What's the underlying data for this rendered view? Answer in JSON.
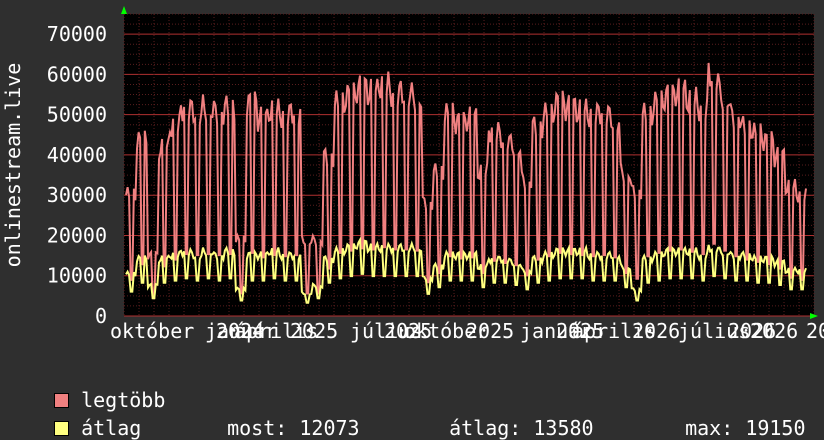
{
  "chart_data": {
    "type": "line",
    "ylabel": "onlinestream.live",
    "yticks": [
      "0",
      "10000",
      "20000",
      "30000",
      "40000",
      "50000",
      "60000",
      "70000"
    ],
    "ylim": [
      0,
      75000
    ],
    "x_tick_labels": [
      "október",
      "január",
      "2024",
      "április",
      "2025",
      "július",
      "2025",
      "október",
      "2025",
      "január",
      "2025",
      "április",
      "2026",
      "július",
      "2026",
      "2026",
      "20"
    ],
    "grid": true,
    "series": [
      {
        "name": "legtöbb",
        "color": "#f08080",
        "values": [
          32000,
          46000,
          16000,
          44000,
          50000,
          55000,
          54000,
          55000,
          54000,
          55000,
          20000,
          56000,
          52000,
          54000,
          53000,
          54000,
          20000,
          20000,
          42000,
          56000,
          58000,
          60000,
          59000,
          61000,
          59000,
          59000,
          58000,
          30000,
          38000,
          53000,
          51000,
          52000,
          38000,
          49000,
          47000,
          45000,
          36000,
          50000,
          53000,
          56000,
          55000,
          54000,
          53000,
          54000,
          52000,
          38000,
          33000,
          53000,
          56000,
          58000,
          59000,
          57000,
          55000,
          64000,
          58000,
          53000,
          50000,
          48000,
          46000,
          42000,
          34000,
          32000
        ]
      },
      {
        "name": "átlag",
        "color": "#ffff80",
        "values": [
          11000,
          15000,
          8000,
          15000,
          16000,
          17000,
          16000,
          17000,
          16000,
          17000,
          7000,
          16000,
          16000,
          17000,
          16000,
          16000,
          6000,
          8000,
          15000,
          17000,
          18000,
          19000,
          18000,
          18000,
          18000,
          18000,
          18000,
          10000,
          13000,
          16000,
          16000,
          16000,
          13000,
          15000,
          15000,
          14000,
          12000,
          15000,
          16000,
          17000,
          17000,
          17000,
          16000,
          16000,
          16000,
          13000,
          7000,
          15000,
          16000,
          17000,
          17000,
          17000,
          16000,
          18000,
          17000,
          16000,
          16000,
          15000,
          15000,
          14000,
          12000,
          12000
        ]
      }
    ]
  },
  "legend": {
    "items": [
      {
        "label": "legtöbb",
        "color": "#f08080"
      },
      {
        "label": "átlag",
        "color": "#ffff80"
      }
    ]
  },
  "stats": {
    "most_label": "most:",
    "most_value": "12073",
    "atlag_label": "átlag:",
    "atlag_value": "13580",
    "max_label": "max:",
    "max_value": "19150"
  }
}
